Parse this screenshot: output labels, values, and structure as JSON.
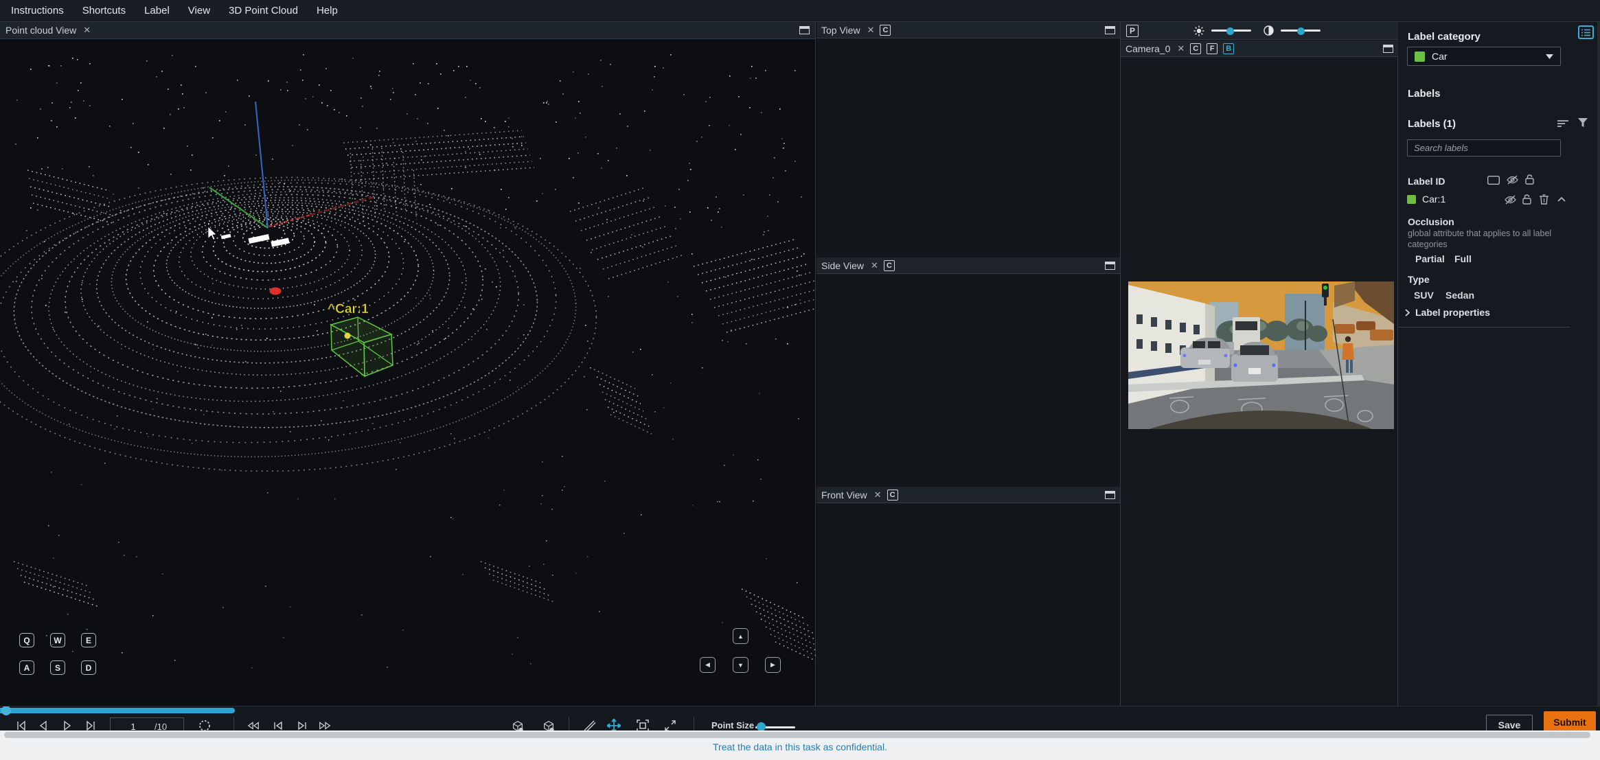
{
  "menu": {
    "items": [
      "Instructions",
      "Shortcuts",
      "Label",
      "View",
      "3D Point Cloud",
      "Help"
    ]
  },
  "point_cloud_panel": {
    "title": "Point cloud View",
    "annotation_label": "^Car:1",
    "keys": [
      "Q",
      "W",
      "E",
      "A",
      "S",
      "D"
    ]
  },
  "views": {
    "top": {
      "title": "Top View",
      "camera_toggle": "C"
    },
    "side": {
      "title": "Side View",
      "camera_toggle": "C"
    },
    "front": {
      "title": "Front View",
      "camera_toggle": "C"
    }
  },
  "camera_panel": {
    "title": "Camera_0",
    "projection_button": "P",
    "toggles": {
      "c": "C",
      "f": "F",
      "b": "B"
    }
  },
  "sidebar": {
    "label_category_heading": "Label category",
    "category": {
      "name": "Car",
      "color": "#6cbf40"
    },
    "labels_heading": "Labels",
    "labels_count_heading": "Labels (1)",
    "search_placeholder": "Search labels",
    "label_id_heading": "Label ID",
    "label": {
      "name": "Car:1",
      "color": "#6cbf40"
    },
    "occlusion_heading": "Occlusion",
    "occlusion_description": "global attribute that applies to all label categories",
    "occlusion_options": [
      "Partial",
      "Full"
    ],
    "type_heading": "Type",
    "type_options": [
      "SUV",
      "Sedan"
    ],
    "label_properties_heading": "Label properties"
  },
  "timeline": {
    "frame_current": "1",
    "frame_total": "/10",
    "point_size_label": "Point Size"
  },
  "actions": {
    "save": "Save",
    "submit": "Submit"
  },
  "footer": {
    "message": "Treat the data in this task as confidential."
  },
  "colors": {
    "accent_blue": "#39aed6",
    "submit_orange": "#e97110",
    "label_green": "#6cbf40",
    "cuboid_green": "#5ec93e"
  }
}
